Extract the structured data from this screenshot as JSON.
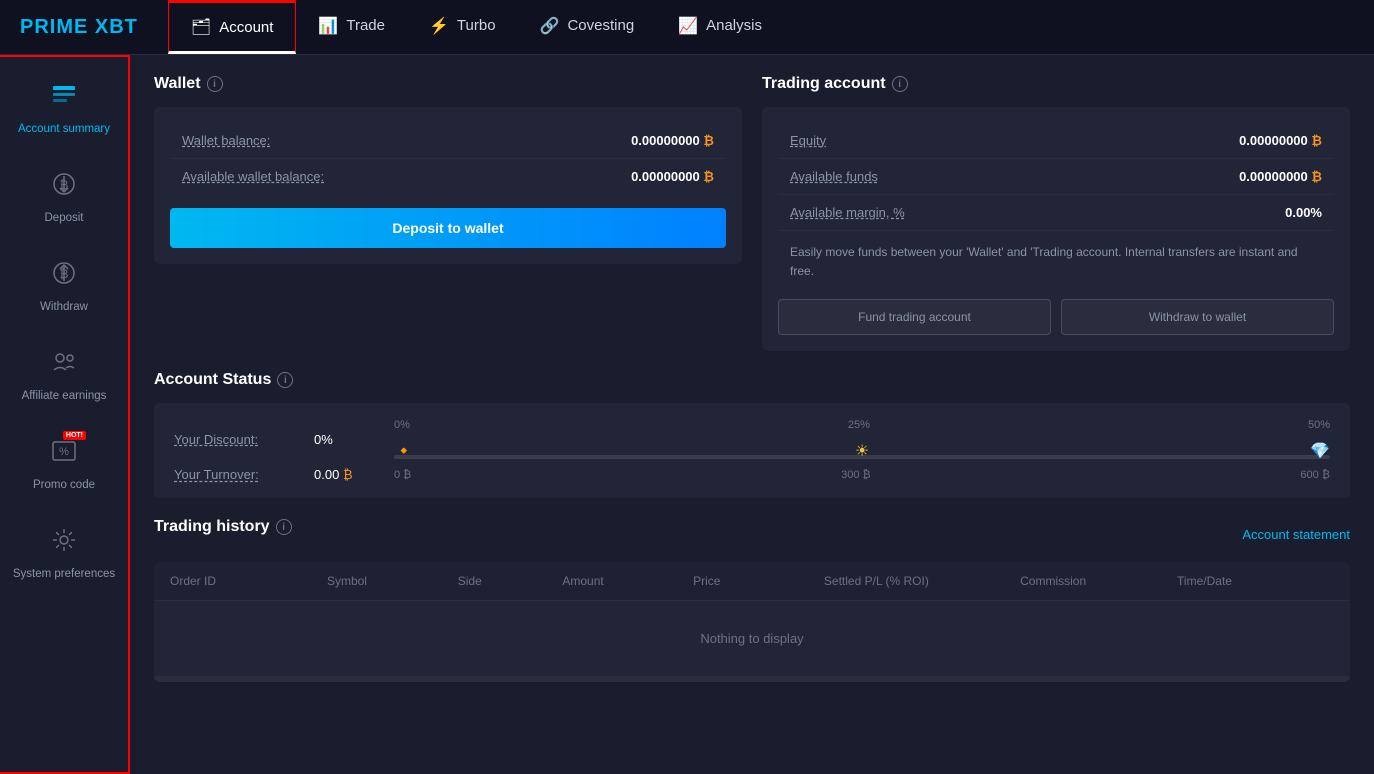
{
  "logo": {
    "prime": "PRIME",
    "xbt": " XBT"
  },
  "nav": {
    "items": [
      {
        "id": "account",
        "label": "Account",
        "icon": "🗂",
        "active": true
      },
      {
        "id": "trade",
        "label": "Trade",
        "icon": "📊",
        "active": false
      },
      {
        "id": "turbo",
        "label": "Turbo",
        "icon": "⚡",
        "active": false
      },
      {
        "id": "covesting",
        "label": "Covesting",
        "icon": "🔗",
        "active": false
      },
      {
        "id": "analysis",
        "label": "Analysis",
        "icon": "📈",
        "active": false
      }
    ]
  },
  "sidebar": {
    "items": [
      {
        "id": "account-summary",
        "label": "Account summary",
        "icon": "🏠",
        "active": true
      },
      {
        "id": "deposit",
        "label": "Deposit",
        "icon": "⬇",
        "active": false
      },
      {
        "id": "withdraw",
        "label": "Withdraw",
        "icon": "⬆",
        "active": false
      },
      {
        "id": "affiliate-earnings",
        "label": "Affiliate earnings",
        "icon": "👥",
        "active": false
      },
      {
        "id": "promo-code",
        "label": "Promo code",
        "icon": "🏷",
        "active": false,
        "hot": true
      },
      {
        "id": "system-preferences",
        "label": "System preferences",
        "icon": "⚙",
        "active": false
      }
    ]
  },
  "wallet": {
    "title": "Wallet",
    "wallet_balance_label": "Wallet balance:",
    "wallet_balance_value": "0.00000000",
    "available_wallet_label": "Available wallet balance:",
    "available_wallet_value": "0.00000000",
    "deposit_btn": "Deposit to wallet",
    "btc_symbol": "₿"
  },
  "trading_account": {
    "title": "Trading account",
    "equity_label": "Equity",
    "equity_value": "0.00000000",
    "available_funds_label": "Available funds",
    "available_funds_value": "0.00000000",
    "available_margin_label": "Available margin, %",
    "available_margin_value": "0.00%",
    "transfer_text": "Easily move funds between your 'Wallet' and 'Trading account. Internal transfers are instant and free.",
    "fund_btn": "Fund trading account",
    "withdraw_btn": "Withdraw to wallet",
    "btc_symbol": "₿"
  },
  "account_status": {
    "title": "Account Status",
    "discount_label": "Your Discount:",
    "discount_value": "0%",
    "discount_levels": [
      "0%",
      "25%",
      "50%"
    ],
    "turnover_label": "Your Turnover:",
    "turnover_value": "0.00",
    "turnover_levels": [
      "0 ₿",
      "300 ₿",
      "600 ₿"
    ],
    "btc_symbol": "₿"
  },
  "trading_history": {
    "title": "Trading history",
    "account_statement": "Account statement",
    "columns": [
      "Order ID",
      "Symbol",
      "Side",
      "Amount",
      "Price",
      "Settled P/L (% ROI)",
      "Commission",
      "Time/Date"
    ],
    "empty_text": "Nothing to display"
  }
}
